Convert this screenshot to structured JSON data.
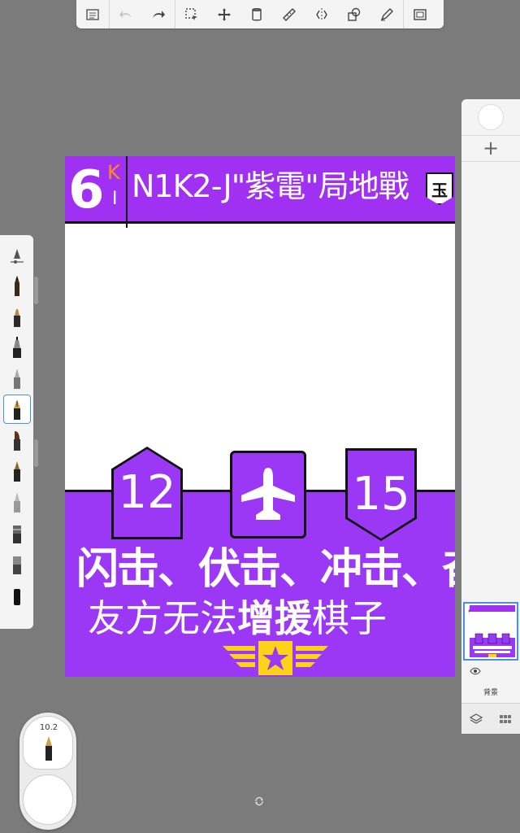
{
  "toolbar": {
    "tools": [
      "menu-list",
      "undo",
      "redo",
      "selection",
      "transform",
      "fill",
      "ruler",
      "symmetry",
      "shapes",
      "pen-tool",
      "canvas-view"
    ]
  },
  "brushes": {
    "selected_index": 4,
    "items": [
      "pencil",
      "airbrush",
      "marker",
      "paintbrush",
      "ink-pen",
      "chisel-pen",
      "fountain-pen",
      "fine-point",
      "flat-brush",
      "blender",
      "eraser"
    ]
  },
  "artwork": {
    "chapter_number": "6",
    "chapter_k": "K",
    "chapter_i": "I",
    "title": "N1K2-J\"紫電\"局地戰",
    "jade_badge": "玉",
    "left_token": "12",
    "right_token": "15",
    "slogan": "闪击、伏击、冲击、奋战",
    "subtitle_pre": "友方无法",
    "subtitle_strong": "增援",
    "subtitle_post": "棋子",
    "colors": {
      "purple_header": "#a031f2",
      "purple_band": "#9b38f5",
      "emblem_yellow": "#ffd21a",
      "kanji_orange": "#ff8c1a"
    }
  },
  "layers": {
    "add_label": "+",
    "background_label": "背景"
  },
  "brush_puck": {
    "size": "10.2"
  }
}
